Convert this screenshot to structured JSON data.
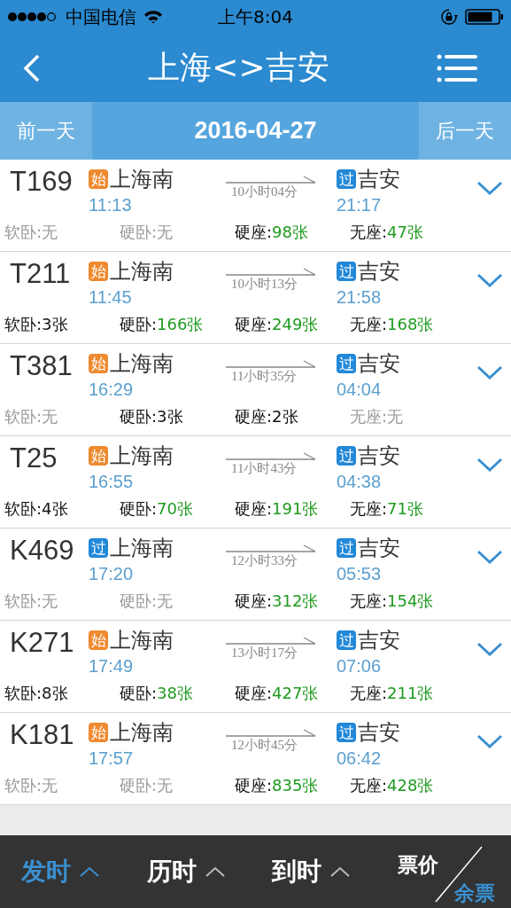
{
  "status_bar": {
    "carrier": "中国电信",
    "time": "上午8:04"
  },
  "nav": {
    "title": "上海<>吉安"
  },
  "date_bar": {
    "prev": "前一天",
    "date": "2016-04-27",
    "next": "后一天"
  },
  "trains": [
    {
      "number": "T169",
      "from_badge": {
        "kind": "origin",
        "text": "始"
      },
      "from": "上海南",
      "depart": "11:13",
      "duration": "10小时04分",
      "to_badge": {
        "kind": "passing",
        "text": "过"
      },
      "to": "吉安",
      "arrive": "21:17",
      "seats": [
        {
          "label": "软卧:",
          "value": "无",
          "available": false,
          "color": "#999999"
        },
        {
          "label": "硬卧:",
          "value": "无",
          "available": false,
          "color": "#999999"
        },
        {
          "label": "硬座:",
          "value": "98张",
          "available": true,
          "color": "#1e9a1e"
        },
        {
          "label": "无座:",
          "value": "47张",
          "available": true,
          "color": "#1e9a1e"
        }
      ]
    },
    {
      "number": "T211",
      "from_badge": {
        "kind": "origin",
        "text": "始"
      },
      "from": "上海南",
      "depart": "11:45",
      "duration": "10小时13分",
      "to_badge": {
        "kind": "passing",
        "text": "过"
      },
      "to": "吉安",
      "arrive": "21:58",
      "seats": [
        {
          "label": "软卧:",
          "value": "3张",
          "available": true,
          "color": "#111111"
        },
        {
          "label": "硬卧:",
          "value": "166张",
          "available": true,
          "color": "#1e9a1e"
        },
        {
          "label": "硬座:",
          "value": "249张",
          "available": true,
          "color": "#1e9a1e"
        },
        {
          "label": "无座:",
          "value": "168张",
          "available": true,
          "color": "#1e9a1e"
        }
      ]
    },
    {
      "number": "T381",
      "from_badge": {
        "kind": "origin",
        "text": "始"
      },
      "from": "上海南",
      "depart": "16:29",
      "duration": "11小时35分",
      "to_badge": {
        "kind": "passing",
        "text": "过"
      },
      "to": "吉安",
      "arrive": "04:04",
      "seats": [
        {
          "label": "软卧:",
          "value": "无",
          "available": false,
          "color": "#999999"
        },
        {
          "label": "硬卧:",
          "value": "3张",
          "available": true,
          "color": "#111111"
        },
        {
          "label": "硬座:",
          "value": "2张",
          "available": true,
          "color": "#111111"
        },
        {
          "label": "无座:",
          "value": "无",
          "available": false,
          "color": "#999999"
        }
      ]
    },
    {
      "number": "T25",
      "from_badge": {
        "kind": "origin",
        "text": "始"
      },
      "from": "上海南",
      "depart": "16:55",
      "duration": "11小时43分",
      "to_badge": {
        "kind": "passing",
        "text": "过"
      },
      "to": "吉安",
      "arrive": "04:38",
      "seats": [
        {
          "label": "软卧:",
          "value": "4张",
          "available": true,
          "color": "#111111"
        },
        {
          "label": "硬卧:",
          "value": "70张",
          "available": true,
          "color": "#1e9a1e"
        },
        {
          "label": "硬座:",
          "value": "191张",
          "available": true,
          "color": "#1e9a1e"
        },
        {
          "label": "无座:",
          "value": "71张",
          "available": true,
          "color": "#1e9a1e"
        }
      ]
    },
    {
      "number": "K469",
      "from_badge": {
        "kind": "passing",
        "text": "过"
      },
      "from": "上海南",
      "depart": "17:20",
      "duration": "12小时33分",
      "to_badge": {
        "kind": "passing",
        "text": "过"
      },
      "to": "吉安",
      "arrive": "05:53",
      "seats": [
        {
          "label": "软卧:",
          "value": "无",
          "available": false,
          "color": "#999999"
        },
        {
          "label": "硬卧:",
          "value": "无",
          "available": false,
          "color": "#999999"
        },
        {
          "label": "硬座:",
          "value": "312张",
          "available": true,
          "color": "#1e9a1e"
        },
        {
          "label": "无座:",
          "value": "154张",
          "available": true,
          "color": "#1e9a1e"
        }
      ]
    },
    {
      "number": "K271",
      "from_badge": {
        "kind": "origin",
        "text": "始"
      },
      "from": "上海南",
      "depart": "17:49",
      "duration": "13小时17分",
      "to_badge": {
        "kind": "passing",
        "text": "过"
      },
      "to": "吉安",
      "arrive": "07:06",
      "seats": [
        {
          "label": "软卧:",
          "value": "8张",
          "available": true,
          "color": "#111111"
        },
        {
          "label": "硬卧:",
          "value": "38张",
          "available": true,
          "color": "#1e9a1e"
        },
        {
          "label": "硬座:",
          "value": "427张",
          "available": true,
          "color": "#1e9a1e"
        },
        {
          "label": "无座:",
          "value": "211张",
          "available": true,
          "color": "#1e9a1e"
        }
      ]
    },
    {
      "number": "K181",
      "from_badge": {
        "kind": "origin",
        "text": "始"
      },
      "from": "上海南",
      "depart": "17:57",
      "duration": "12小时45分",
      "to_badge": {
        "kind": "passing",
        "text": "过"
      },
      "to": "吉安",
      "arrive": "06:42",
      "seats": [
        {
          "label": "软卧:",
          "value": "无",
          "available": false,
          "color": "#999999"
        },
        {
          "label": "硬卧:",
          "value": "无",
          "available": false,
          "color": "#999999"
        },
        {
          "label": "硬座:",
          "value": "835张",
          "available": true,
          "color": "#1e9a1e"
        },
        {
          "label": "无座:",
          "value": "428张",
          "available": true,
          "color": "#1e9a1e"
        }
      ]
    }
  ],
  "sort_bar": {
    "items": [
      {
        "label": "发时",
        "selected": true
      },
      {
        "label": "历时",
        "selected": false
      },
      {
        "label": "到时",
        "selected": false
      }
    ],
    "price_toggle": [
      {
        "label": "票价",
        "selected": false
      },
      {
        "label": "余票",
        "selected": true
      }
    ]
  }
}
